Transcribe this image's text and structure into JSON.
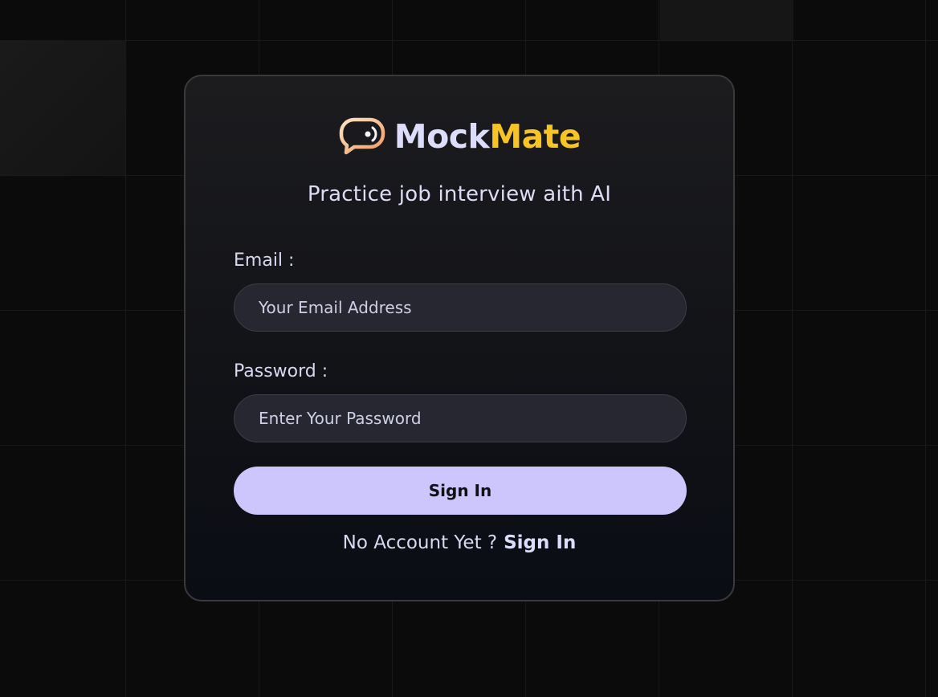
{
  "brand": {
    "name_part1": "Mock",
    "name_part2": "Mate",
    "icon": "chat-bubble-sound-icon",
    "colors": {
      "mock": "#dcdcfb",
      "mate": "#f7c325",
      "icon_gradient": [
        "#fbd7ae",
        "#f2a06a"
      ]
    }
  },
  "tagline": "Practice job interview aith AI",
  "form": {
    "email_label": "Email :",
    "email_placeholder": "Your Email Address",
    "email_value": "",
    "password_label": "Password :",
    "password_placeholder": "Enter Your Password",
    "password_value": "",
    "submit_label": "Sign In"
  },
  "footer": {
    "prompt": "No Account Yet ?",
    "link_label": "Sign In"
  },
  "colors": {
    "background": "#0b0b0b",
    "card_border": "#3a3a3c",
    "input_bg": "#262730",
    "button_bg": "#cdc6fd",
    "text": "#d8d8f2"
  }
}
